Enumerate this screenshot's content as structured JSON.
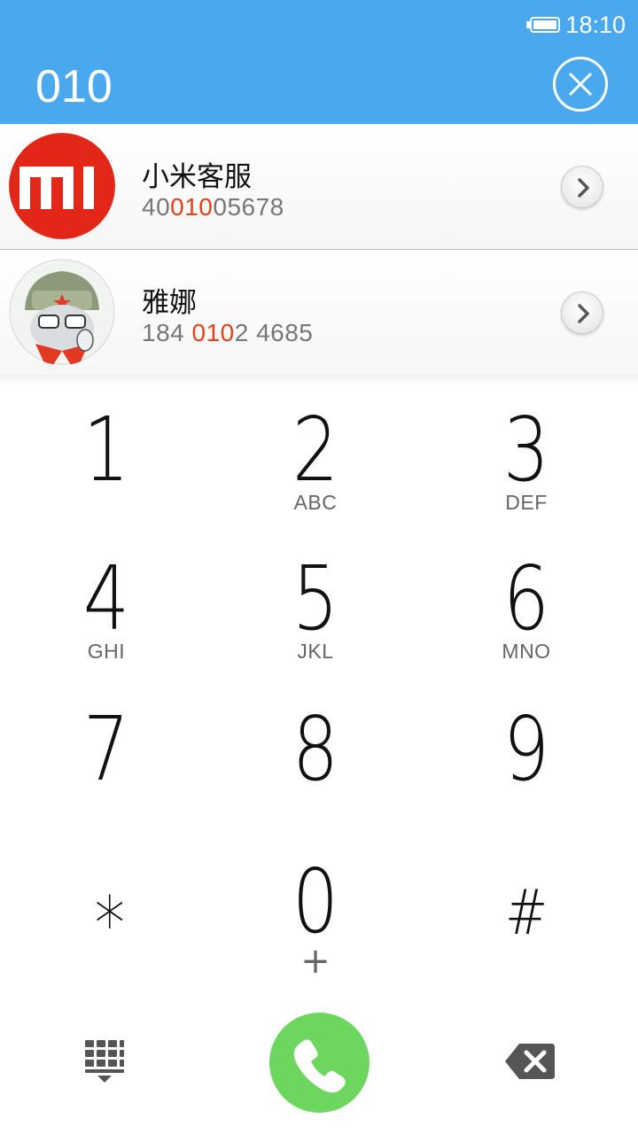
{
  "status_bar": {
    "time": "18:10",
    "battery_icon": "battery-full-icon"
  },
  "header": {
    "dialed_number": "010",
    "clear_icon": "close-circle-icon",
    "background": "#4aa8ee"
  },
  "contacts": [
    {
      "name": "小米客服",
      "number_parts": [
        "40",
        "010",
        "05678"
      ],
      "avatar": "mi-logo-avatar",
      "detail_icon": "chevron-right-icon"
    },
    {
      "name": "雅娜",
      "number_parts": [
        "184 ",
        "010",
        "2 4685"
      ],
      "avatar": "mitu-bunny-avatar",
      "detail_icon": "chevron-right-icon"
    }
  ],
  "keypad": [
    {
      "digit": "1",
      "letters": ""
    },
    {
      "digit": "2",
      "letters": "ABC"
    },
    {
      "digit": "3",
      "letters": "DEF"
    },
    {
      "digit": "4",
      "letters": "GHI"
    },
    {
      "digit": "5",
      "letters": "JKL"
    },
    {
      "digit": "6",
      "letters": "MNO"
    },
    {
      "digit": "7",
      "letters": ""
    },
    {
      "digit": "8",
      "letters": ""
    },
    {
      "digit": "9",
      "letters": ""
    },
    {
      "digit": "∗",
      "letters": ""
    },
    {
      "digit": "0",
      "letters": "+"
    },
    {
      "digit": "#",
      "letters": ""
    }
  ],
  "actions": {
    "dialpad_icon": "dialpad-collapse-icon",
    "call_icon": "phone-call-icon",
    "backspace_icon": "backspace-icon",
    "call_color": "#6cd65e",
    "highlight_color": "#e0421a"
  }
}
